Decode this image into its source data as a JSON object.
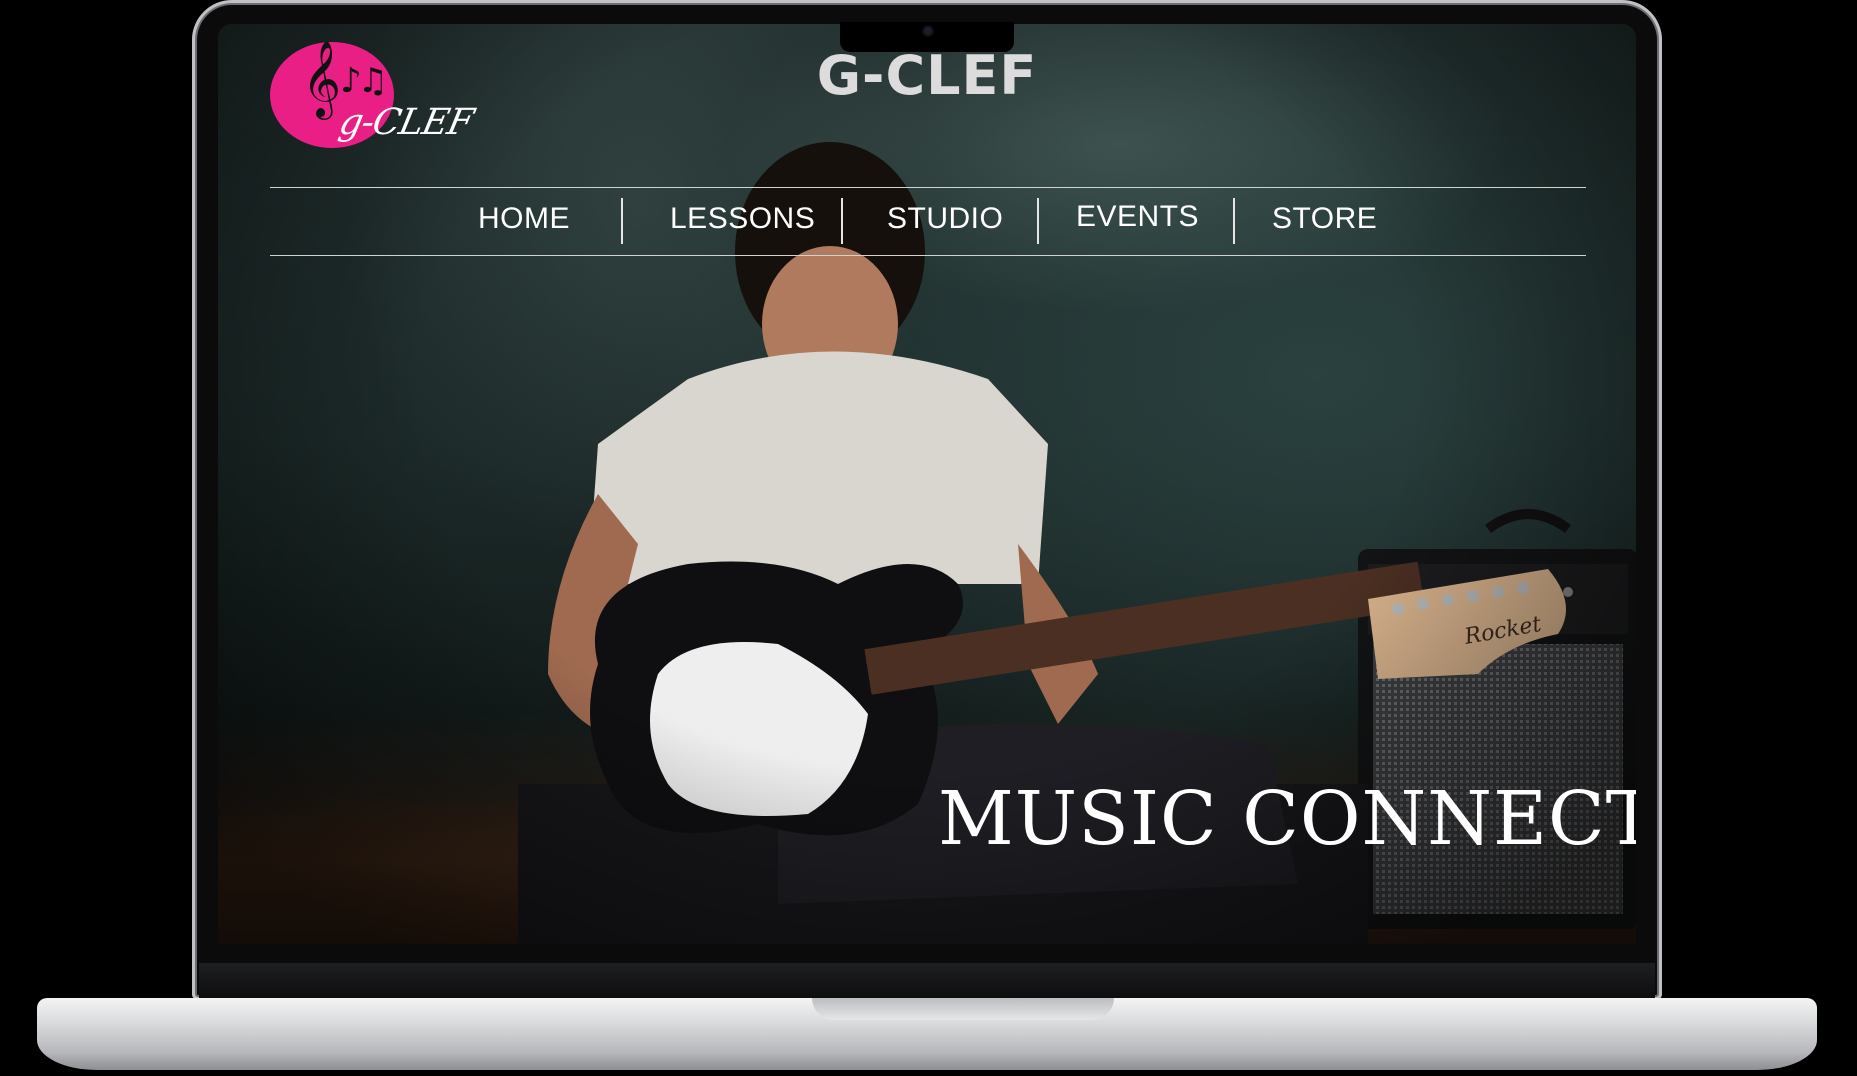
{
  "site": {
    "title": "G-CLEF",
    "logo_text": "g-CLEF",
    "logo_icon": "treble-clef-icon",
    "brand_color": "#ea1f85"
  },
  "nav": {
    "items": [
      {
        "label": "HOME"
      },
      {
        "label": "LESSONS"
      },
      {
        "label": "STUDIO"
      },
      {
        "label": "EVENTS"
      },
      {
        "label": "STORE"
      }
    ]
  },
  "hero": {
    "tagline": "MUSIC CONNECTS",
    "guitar_brand": "Rocket"
  }
}
